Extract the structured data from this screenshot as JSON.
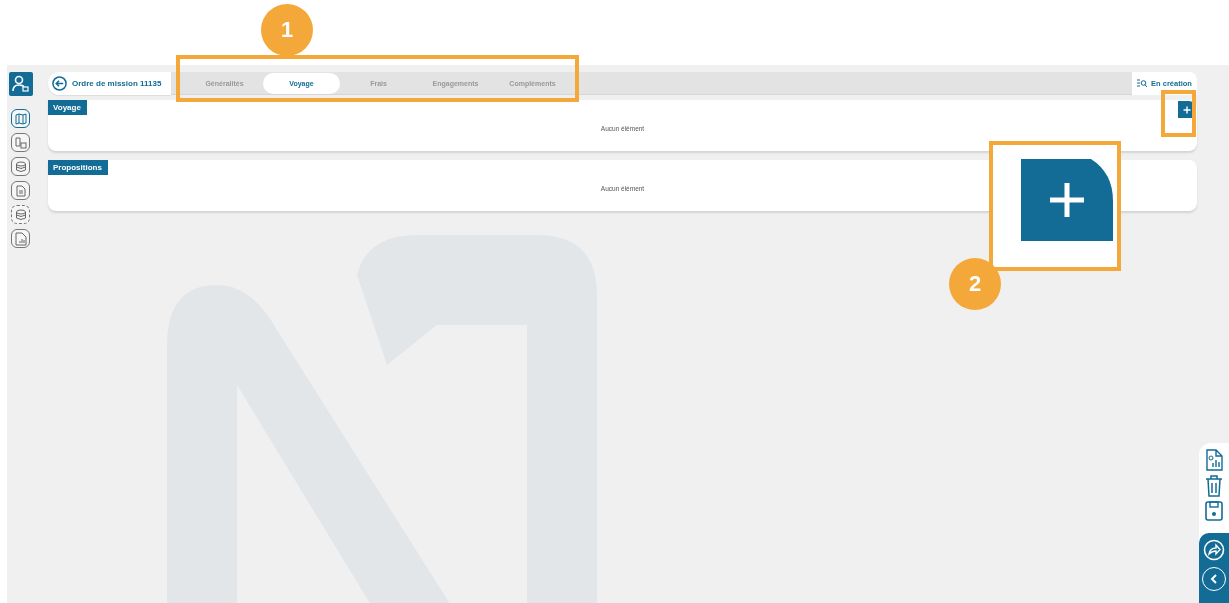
{
  "record": {
    "title": "Ordre de mission 11135",
    "status": "En création"
  },
  "sidebar_items": [
    {
      "kind": "map",
      "selected": true
    },
    {
      "kind": "calendar",
      "selected": false
    },
    {
      "kind": "coins",
      "selected": false
    },
    {
      "kind": "document",
      "selected": false
    },
    {
      "kind": "coins-dashed",
      "selected": false
    },
    {
      "kind": "report",
      "selected": false
    }
  ],
  "tabs": [
    {
      "label": "Généralités",
      "selected": false
    },
    {
      "label": "Voyage",
      "selected": true
    },
    {
      "label": "Frais",
      "selected": false
    },
    {
      "label": "Engagements",
      "selected": false
    },
    {
      "label": "Compléments",
      "selected": false
    }
  ],
  "sections": [
    {
      "title": "Voyage",
      "empty_text": "Aucun élément",
      "has_add": true
    },
    {
      "title": "Propositions",
      "empty_text": "Aucun élément",
      "has_add": false
    }
  ],
  "callouts": [
    {
      "number": "1"
    },
    {
      "number": "2"
    }
  ]
}
